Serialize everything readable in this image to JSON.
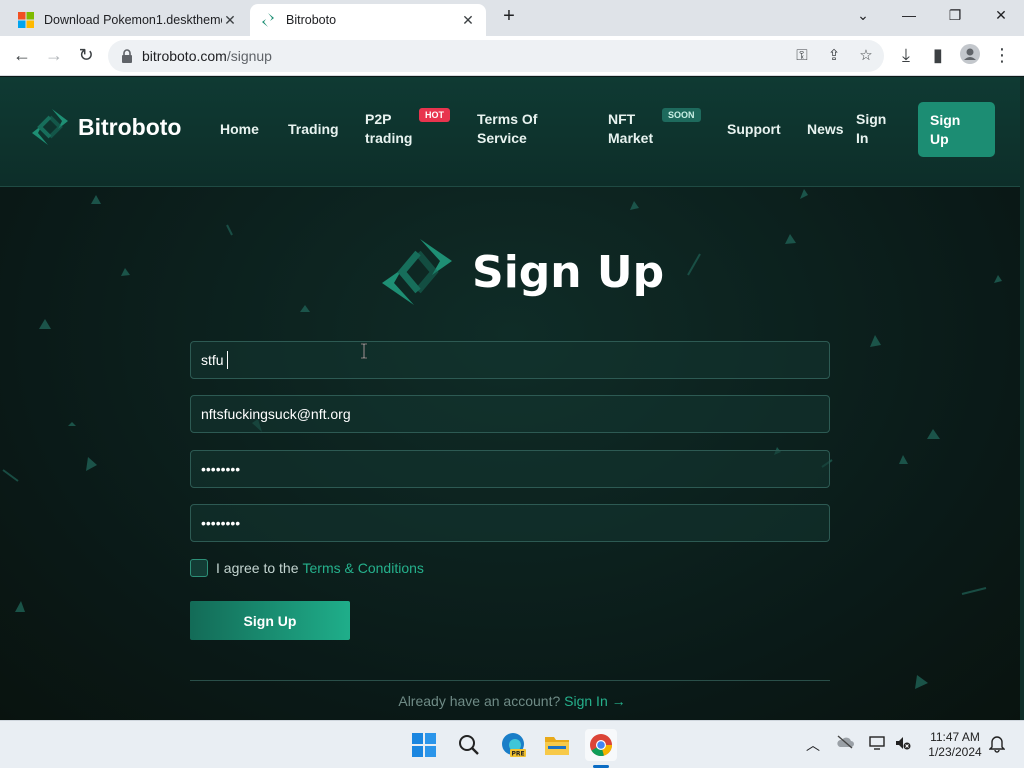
{
  "browser": {
    "tabs": [
      {
        "title": "Download Pokemon1.desktheme",
        "active": false
      },
      {
        "title": "Bitroboto",
        "active": true
      }
    ],
    "new_tab": "+",
    "window_controls": [
      "⌄",
      "—",
      "❐",
      "✕"
    ],
    "address": {
      "domain": "bitroboto.com",
      "path": "/signup"
    }
  },
  "site": {
    "brand": "Bitroboto",
    "nav": {
      "home": "Home",
      "trading": "Trading",
      "p2p_line1": "P2P",
      "p2p_line2": "trading",
      "hot_badge": "HOT",
      "terms_line1": "Terms Of",
      "terms_line2": "Service",
      "nft_line1": "NFT",
      "nft_line2": "Market",
      "soon_badge": "SOON",
      "support": "Support",
      "news": "News",
      "signin_line1": "Sign",
      "signin_line2": "In",
      "signup_line1": "Sign",
      "signup_line2": "Up"
    },
    "form": {
      "heading": "Sign Up",
      "username_value": "stfu",
      "email_value": "nftsfuckingsuck@nft.org",
      "password_value": "••••••••",
      "confirm_password_value": "••••••••",
      "agree_text": "I agree to the",
      "terms_link": "Terms & Conditions",
      "submit_label": "Sign Up",
      "already_text": "Already have an account?",
      "signin_link": "Sign In",
      "signin_arrow": "→"
    },
    "colors": {
      "accent": "#1fae8a",
      "background": "#0b1a18"
    }
  },
  "taskbar": {
    "clock_time": "11:47 AM",
    "clock_date": "1/23/2024",
    "edge_badge": "PRE"
  }
}
